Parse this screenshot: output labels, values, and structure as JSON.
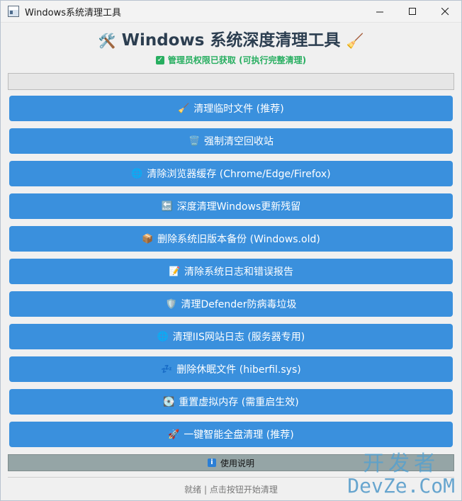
{
  "window": {
    "title": "Windows系统清理工具",
    "controls": {
      "minimize": "minimize-icon",
      "maximize": "maximize-icon",
      "close": "close-icon"
    }
  },
  "header": {
    "title": "Windows 系统深度清理工具",
    "left_emoji": "🛠️",
    "right_emoji": "🧹",
    "admin_status": "管理员权限已获取 (可执行完整清理)"
  },
  "progress": {
    "value": 0
  },
  "buttons": [
    {
      "icon": "🧹",
      "label": "清理临时文件 (推荐)"
    },
    {
      "icon": "🗑️",
      "label": "强制清空回收站"
    },
    {
      "icon": "🌐",
      "label": "清除浏览器缓存 (Chrome/Edge/Firefox)"
    },
    {
      "icon": "🔙",
      "label": "深度清理Windows更新残留"
    },
    {
      "icon": "📦",
      "label": "删除系统旧版本备份 (Windows.old)"
    },
    {
      "icon": "📝",
      "label": "清除系统日志和错误报告"
    },
    {
      "icon": "🛡️",
      "label": "清理Defender防病毒垃圾"
    },
    {
      "icon": "🌐",
      "label": "清理IIS网站日志 (服务器专用)"
    },
    {
      "icon": "💤",
      "label": "删除休眠文件 (hiberfil.sys)"
    },
    {
      "icon": "💽",
      "label": "重置虚拟内存 (需重启生效)"
    },
    {
      "icon": "🚀",
      "label": "一键智能全盘清理 (推荐)"
    }
  ],
  "help": {
    "label": "使用说明"
  },
  "status": {
    "text": "就绪 | 点击按钮开始清理"
  },
  "watermark": {
    "top": "开发者",
    "bottom": "DevZe.CoM"
  },
  "colors": {
    "button_bg": "#3a90dd",
    "title_text": "#2c3e50",
    "admin_green": "#27ae60",
    "help_bar": "#95a5a6"
  }
}
